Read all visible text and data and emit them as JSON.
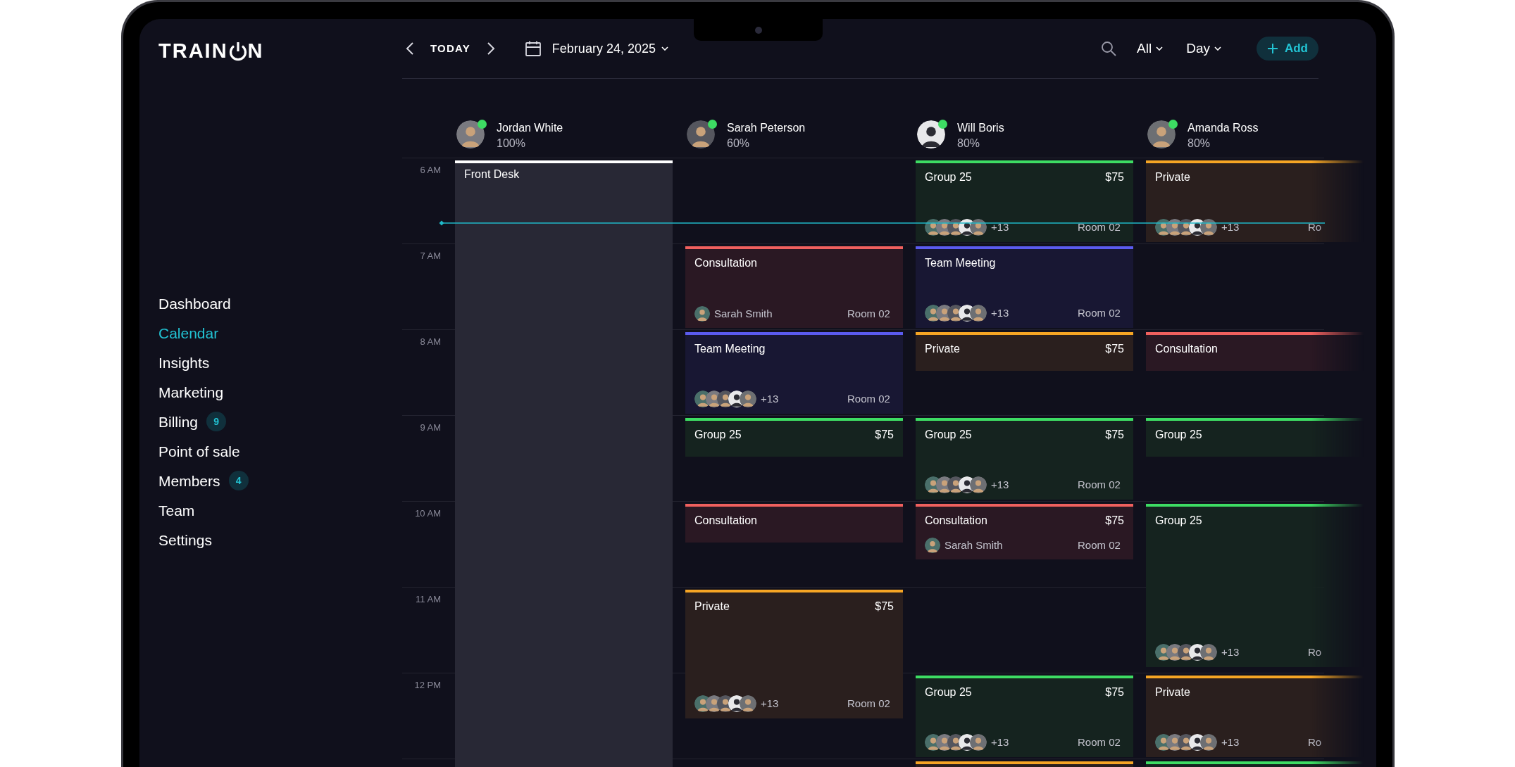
{
  "logo": {
    "text_before": "TRAIN",
    "text_after": "N"
  },
  "sidebar": {
    "items": [
      {
        "label": "Dashboard",
        "selected": false
      },
      {
        "label": "Calendar",
        "selected": true
      },
      {
        "label": "Insights",
        "selected": false
      },
      {
        "label": "Marketing",
        "selected": false
      },
      {
        "label": "Billing",
        "selected": false,
        "badge": "9"
      },
      {
        "label": "Point of sale",
        "selected": false
      },
      {
        "label": "Members",
        "selected": false,
        "badge": "4"
      },
      {
        "label": "Team",
        "selected": false
      },
      {
        "label": "Settings",
        "selected": false
      }
    ]
  },
  "toolbar": {
    "today": "TODAY",
    "date": "February 24, 2025",
    "filter": "All",
    "view": "Day",
    "add": "Add"
  },
  "hours": [
    "6 AM",
    "7 AM",
    "8 AM",
    "9 AM",
    "10 AM",
    "11 AM",
    "12 PM"
  ],
  "staff": [
    {
      "name": "Jordan White",
      "load": "100%",
      "online": true,
      "slots": [
        {
          "kind": "shift",
          "title": "Front Desk",
          "color": "#ffffff"
        }
      ]
    },
    {
      "name": "Sarah Peterson",
      "load": "60%",
      "online": true,
      "slots": [
        {
          "kind": "open"
        },
        {
          "kind": "hour",
          "title": "Consultation",
          "color": "#f0605e",
          "footer": {
            "kind": "person",
            "name": "Sarah Smith",
            "room": "Room 02"
          }
        },
        {
          "kind": "hour",
          "title": "Team Meeting",
          "color": "#5b5bef",
          "footer": {
            "kind": "group",
            "count": "+13",
            "room": "Room 02"
          }
        },
        {
          "kind": "half",
          "title": "Group 25",
          "price": "$75",
          "color": "#3ddc63"
        },
        {
          "kind": "half",
          "title": "Consultation",
          "color": "#f0605e"
        },
        {
          "kind": "long",
          "title": "Private",
          "price": "$75",
          "color": "#f5a524",
          "footer": {
            "kind": "group",
            "count": "+13",
            "room": "Room 02"
          }
        }
      ]
    },
    {
      "name": "Will Boris",
      "load": "80%",
      "online": true,
      "slots": [
        {
          "kind": "hour",
          "title": "Group 25",
          "price": "$75",
          "color": "#3ddc63",
          "footer": {
            "kind": "group",
            "count": "+13",
            "room": "Room 02"
          }
        },
        {
          "kind": "hour",
          "title": "Team Meeting",
          "color": "#5b5bef",
          "footer": {
            "kind": "group",
            "count": "+13",
            "room": "Room 02"
          }
        },
        {
          "kind": "half",
          "title": "Private",
          "price": "$75",
          "color": "#f5a524"
        },
        {
          "kind": "hour",
          "title": "Group 25",
          "price": "$75",
          "color": "#3ddc63",
          "footer": {
            "kind": "group",
            "count": "+13",
            "room": "Room 02"
          }
        },
        {
          "kind": "short",
          "title": "Consultation",
          "price": "$75",
          "color": "#f0605e",
          "footer": {
            "kind": "person",
            "name": "Sarah Smith",
            "room": "Room 02"
          }
        },
        {
          "kind": "open"
        },
        {
          "kind": "hour",
          "title": "Group 25",
          "price": "$75",
          "color": "#3ddc63",
          "footer": {
            "kind": "group",
            "count": "+13",
            "room": "Room 02"
          }
        },
        {
          "kind": "hour",
          "color": "#f5a524"
        }
      ]
    },
    {
      "name": "Amanda Ross",
      "load": "80%",
      "online": true,
      "slots": [
        {
          "kind": "hour",
          "title": "Private",
          "color": "#f5a524",
          "footer": {
            "kind": "group",
            "count": "+13",
            "room": "Ro"
          }
        },
        {
          "kind": "open"
        },
        {
          "kind": "half",
          "title": "Consultation",
          "color": "#f0605e"
        },
        {
          "kind": "half",
          "title": "Group 25",
          "color": "#3ddc63"
        },
        {
          "kind": "double",
          "title": "Group 25",
          "color": "#3ddc63",
          "footer": {
            "kind": "group",
            "count": "+13",
            "room": "Ro"
          }
        },
        {
          "kind": "open"
        },
        {
          "kind": "hour",
          "title": "Private",
          "color": "#f5a524",
          "footer": {
            "kind": "group",
            "count": "+13",
            "room": "Ro"
          }
        },
        {
          "kind": "hour",
          "color": "#3ddc63"
        }
      ]
    }
  ]
}
